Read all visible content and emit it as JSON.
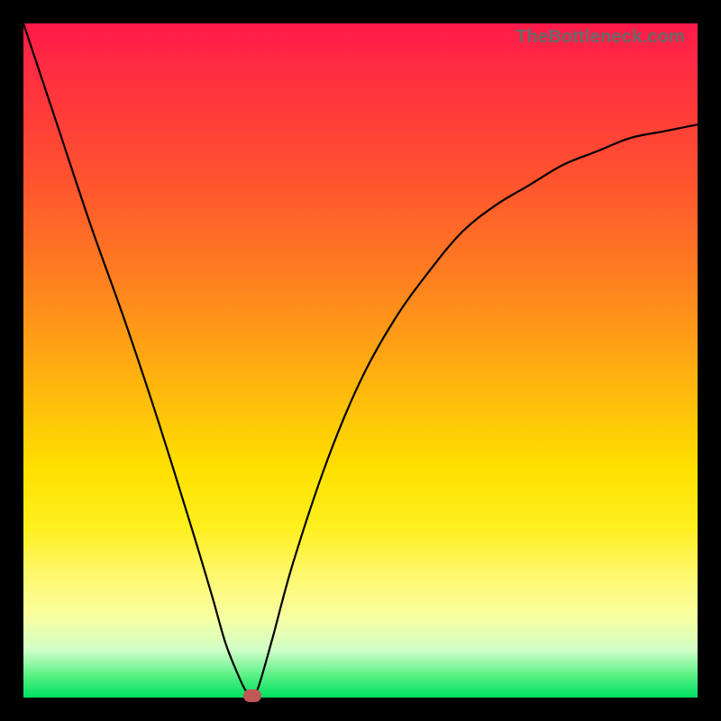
{
  "watermark": "TheBottleneck.com",
  "chart_data": {
    "type": "line",
    "title": "",
    "xlabel": "",
    "ylabel": "",
    "xlim": [
      0,
      100
    ],
    "ylim": [
      0,
      100
    ],
    "series": [
      {
        "name": "curve",
        "x": [
          0,
          5,
          10,
          15,
          20,
          25,
          28,
          30,
          32,
          33,
          34,
          35,
          37,
          40,
          45,
          50,
          55,
          60,
          65,
          70,
          75,
          80,
          85,
          90,
          95,
          100
        ],
        "values": [
          100,
          85,
          70,
          56,
          41,
          25,
          15,
          8,
          3,
          1,
          0,
          2,
          9,
          20,
          35,
          47,
          56,
          63,
          69,
          73,
          76,
          79,
          81,
          83,
          84,
          85
        ]
      }
    ],
    "marker": {
      "x": 34,
      "y": 0,
      "color": "#c05858"
    },
    "gradient_stops": [
      {
        "pos": 0,
        "color": "#ff1a4a"
      },
      {
        "pos": 8,
        "color": "#ff3040"
      },
      {
        "pos": 22,
        "color": "#ff5030"
      },
      {
        "pos": 38,
        "color": "#ff8020"
      },
      {
        "pos": 52,
        "color": "#ffb010"
      },
      {
        "pos": 66,
        "color": "#ffe000"
      },
      {
        "pos": 75,
        "color": "#fff020"
      },
      {
        "pos": 82,
        "color": "#fff870"
      },
      {
        "pos": 88,
        "color": "#f8ffa0"
      },
      {
        "pos": 93,
        "color": "#d0ffc8"
      },
      {
        "pos": 97,
        "color": "#50f080"
      },
      {
        "pos": 100,
        "color": "#00e060"
      }
    ]
  }
}
